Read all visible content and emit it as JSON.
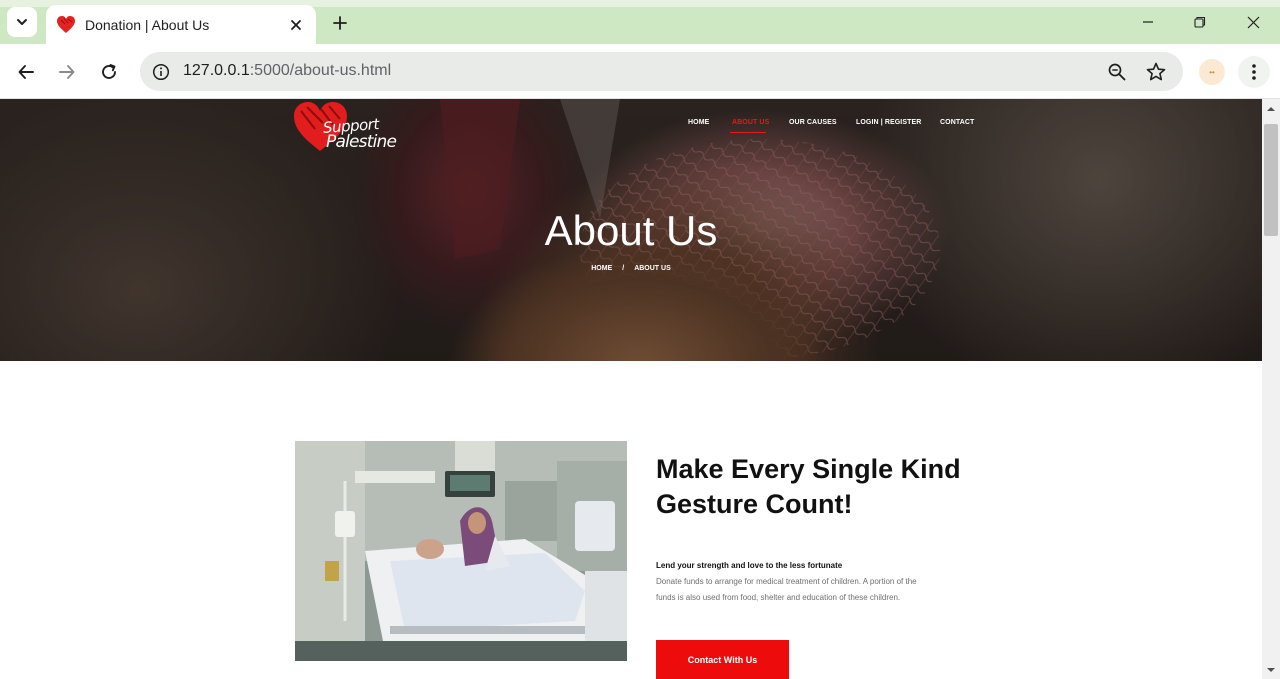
{
  "browser": {
    "tab_title": "Donation | About Us",
    "url_host": "127.0.0.1",
    "url_rest": ":5000/about-us.html"
  },
  "site": {
    "logo_line1": "Support",
    "logo_line2": "Palestine",
    "nav": [
      "HOME",
      "ABOUT US",
      "OUR CAUSES",
      "LOGIN | REGISTER",
      "CONTACT"
    ],
    "active_nav": "ABOUT US"
  },
  "hero": {
    "title": "About Us",
    "breadcrumb_home": "HOME",
    "breadcrumb_sep": "/",
    "breadcrumb_current": "ABOUT US"
  },
  "about": {
    "heading": "Make Every Single Kind Gesture Count!",
    "lead": "Lend your strength and love to the less fortunate",
    "body": "Donate funds to arrange for medical treatment of children. A portion of the funds is also used from food, shelter and education of these children.",
    "button_label": "Contact With Us"
  },
  "colors": {
    "accent": "#ee0b0b",
    "tab_strip": "#cfe8c4"
  },
  "icons": [
    "tab-search-icon",
    "heart-favicon-icon",
    "close-tab-icon",
    "new-tab-icon",
    "minimize-icon",
    "restore-icon",
    "close-window-icon",
    "back-icon",
    "forward-icon",
    "reload-icon",
    "site-info-icon",
    "zoom-icon",
    "bookmark-star-icon",
    "extension-icon",
    "menu-dots-icon"
  ]
}
